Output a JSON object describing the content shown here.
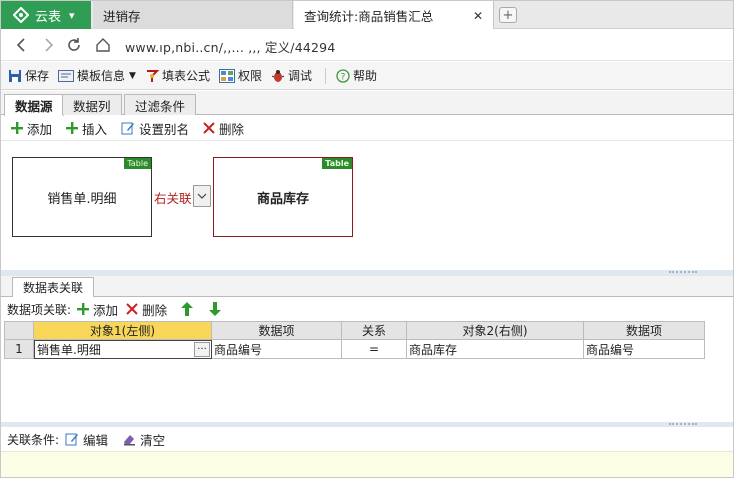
{
  "colors": {
    "brand": "#2f9d54",
    "accent_table_badge": "#2d8a2d",
    "relation_red": "#b02020",
    "header_highlight": "#f7d65a"
  },
  "browser": {
    "brand_label": "云表",
    "tabs": [
      {
        "label": "进销存"
      },
      {
        "label": "查询统计:商品销售汇总"
      }
    ],
    "url": "www.ıp,nbi..cn/,,... ,,, 定义/44294"
  },
  "toolbar": {
    "items": [
      {
        "label": "保存",
        "icon": "save-icon"
      },
      {
        "label": "模板信息",
        "icon": "template-icon"
      },
      {
        "label": "填表公式",
        "icon": "formula-icon"
      },
      {
        "label": "权限",
        "icon": "permission-icon"
      },
      {
        "label": "调试",
        "icon": "debug-icon"
      },
      {
        "label": "帮助",
        "icon": "help-icon"
      }
    ]
  },
  "subtabs": [
    {
      "label": "数据源"
    },
    {
      "label": "数据列"
    },
    {
      "label": "过滤条件"
    }
  ],
  "actions": [
    {
      "label": "添加"
    },
    {
      "label": "插入"
    },
    {
      "label": "设置别名"
    },
    {
      "label": "删除"
    }
  ],
  "diagram": {
    "badge": "Table",
    "left_table": "销售单.明细",
    "relation": "右关联",
    "right_table": "商品库存"
  },
  "lower_tab": "数据表关联",
  "assoc_bar": {
    "label": "数据项关联:",
    "add": "添加",
    "delete": "删除"
  },
  "grid": {
    "headers": [
      "",
      "对象1(左侧)",
      "数据项",
      "关系",
      "对象2(右侧)",
      "数据项"
    ],
    "rows": [
      {
        "num": "1",
        "obj1": "销售单.明细",
        "item1": "商品编号",
        "rel": "=",
        "obj2": "商品库存",
        "item2": "商品编号"
      }
    ]
  },
  "cond_bar": {
    "label": "关联条件:",
    "edit": "编辑",
    "clear": "清空"
  }
}
